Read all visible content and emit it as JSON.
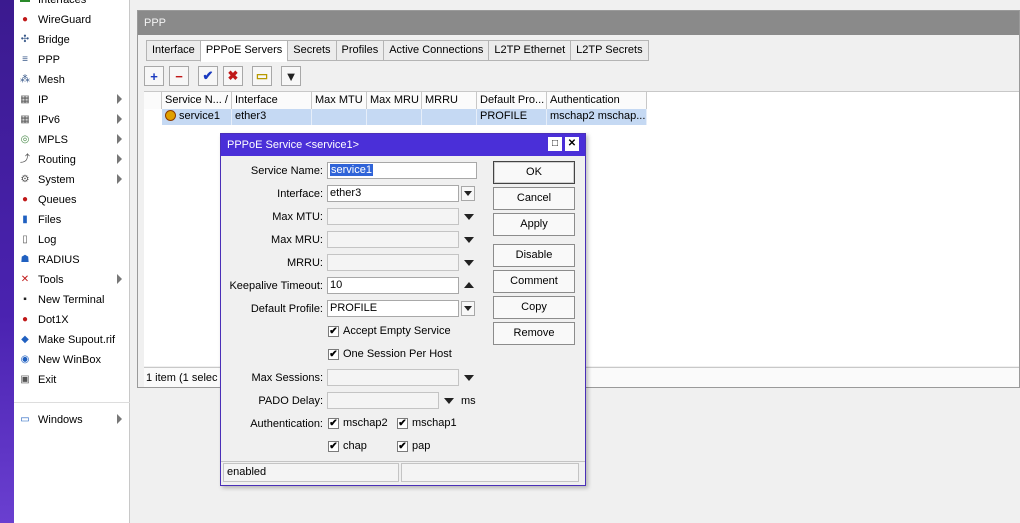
{
  "sidebar": {
    "items": [
      {
        "label": "Interfaces",
        "icon": "interfaces-icon",
        "glyph": "▬",
        "color": "#2a8a2a",
        "has_submenu": false
      },
      {
        "label": "WireGuard",
        "icon": "wireguard-icon",
        "glyph": "●",
        "color": "#c01818",
        "has_submenu": false
      },
      {
        "label": "Bridge",
        "icon": "bridge-icon",
        "glyph": "✣",
        "color": "#3a5a8a",
        "has_submenu": false
      },
      {
        "label": "PPP",
        "icon": "ppp-icon",
        "glyph": "≡",
        "color": "#3a5a8a",
        "has_submenu": false
      },
      {
        "label": "Mesh",
        "icon": "mesh-icon",
        "glyph": "⁂",
        "color": "#3a5a8a",
        "has_submenu": false
      },
      {
        "label": "IP",
        "icon": "ip-icon",
        "glyph": "▦",
        "color": "#555555",
        "has_submenu": true
      },
      {
        "label": "IPv6",
        "icon": "ipv6-icon",
        "glyph": "▦",
        "color": "#555555",
        "has_submenu": true
      },
      {
        "label": "MPLS",
        "icon": "mpls-icon",
        "glyph": "◎",
        "color": "#4a8a4a",
        "has_submenu": true
      },
      {
        "label": "Routing",
        "icon": "routing-icon",
        "glyph": "⤴",
        "color": "#555555",
        "has_submenu": true
      },
      {
        "label": "System",
        "icon": "system-icon",
        "glyph": "⚙",
        "color": "#555555",
        "has_submenu": true
      },
      {
        "label": "Queues",
        "icon": "queues-icon",
        "glyph": "●",
        "color": "#c01818",
        "has_submenu": false
      },
      {
        "label": "Files",
        "icon": "files-icon",
        "glyph": "▮",
        "color": "#2060c0",
        "has_submenu": false
      },
      {
        "label": "Log",
        "icon": "log-icon",
        "glyph": "▯",
        "color": "#555555",
        "has_submenu": false
      },
      {
        "label": "RADIUS",
        "icon": "radius-icon",
        "glyph": "☗",
        "color": "#2060c0",
        "has_submenu": false
      },
      {
        "label": "Tools",
        "icon": "tools-icon",
        "glyph": "✕",
        "color": "#c01818",
        "has_submenu": true
      },
      {
        "label": "New Terminal",
        "icon": "terminal-icon",
        "glyph": "▪",
        "color": "#222222",
        "has_submenu": false
      },
      {
        "label": "Dot1X",
        "icon": "dot1x-icon",
        "glyph": "●",
        "color": "#c01818",
        "has_submenu": false
      },
      {
        "label": "Make Supout.rif",
        "icon": "supout-icon",
        "glyph": "◆",
        "color": "#2060c0",
        "has_submenu": false
      },
      {
        "label": "New WinBox",
        "icon": "winbox-icon",
        "glyph": "◉",
        "color": "#2060c0",
        "has_submenu": false
      },
      {
        "label": "Exit",
        "icon": "exit-icon",
        "glyph": "▣",
        "color": "#555555",
        "has_submenu": false
      }
    ],
    "windows": {
      "label": "Windows",
      "icon": "windows-icon",
      "glyph": "▭",
      "color": "#2060c0",
      "has_submenu": true
    }
  },
  "ppp_window": {
    "title": "PPP",
    "tabs": [
      {
        "label": "Interface",
        "active": false
      },
      {
        "label": "PPPoE Servers",
        "active": true
      },
      {
        "label": "Secrets",
        "active": false
      },
      {
        "label": "Profiles",
        "active": false
      },
      {
        "label": "Active Connections",
        "active": false
      },
      {
        "label": "L2TP Ethernet",
        "active": false
      },
      {
        "label": "L2TP Secrets",
        "active": false
      }
    ],
    "toolbar": {
      "add": {
        "icon": "plus-icon",
        "glyph": "+",
        "color": "#1a3ac0"
      },
      "remove": {
        "icon": "minus-icon",
        "glyph": "−",
        "color": "#c01818"
      },
      "enable": {
        "icon": "check-icon",
        "glyph": "✔",
        "color": "#1a3ac0"
      },
      "disable": {
        "icon": "x-icon",
        "glyph": "✖",
        "color": "#c01818"
      },
      "comment": {
        "icon": "comment-icon",
        "glyph": "▭",
        "color": "#b89a00"
      },
      "filter": {
        "icon": "filter-icon",
        "glyph": "▼",
        "color": "#222222"
      }
    },
    "table": {
      "columns": [
        "Service N... /",
        "Interface",
        "Max MTU",
        "Max MRU",
        "MRRU",
        "Default Pro...",
        "Authentication"
      ],
      "rows": [
        {
          "service": "service1",
          "interface": "ether3",
          "max_mtu": "",
          "max_mru": "",
          "mrru": "",
          "default_profile": "PROFILE",
          "authentication": "mschap2 mschap...",
          "icon": "service-icon"
        }
      ]
    },
    "status": "1 item (1 selec"
  },
  "dialog": {
    "title": "PPPoE Service <service1>",
    "fields": {
      "service_name": {
        "label": "Service Name:",
        "value": "service1"
      },
      "interface": {
        "label": "Interface:",
        "value": "ether3"
      },
      "max_mtu": {
        "label": "Max MTU:",
        "value": ""
      },
      "max_mru": {
        "label": "Max MRU:",
        "value": ""
      },
      "mrru": {
        "label": "MRRU:",
        "value": ""
      },
      "keepalive": {
        "label": "Keepalive Timeout:",
        "value": "10"
      },
      "default_profile": {
        "label": "Default Profile:",
        "value": "PROFILE"
      },
      "max_sessions": {
        "label": "Max Sessions:",
        "value": ""
      },
      "pado_delay": {
        "label": "PADO Delay:",
        "value": "",
        "unit": "ms"
      },
      "authentication": {
        "label": "Authentication:"
      }
    },
    "checkboxes": {
      "accept_empty": {
        "label": "Accept Empty Service",
        "checked": true
      },
      "one_session": {
        "label": "One Session Per Host",
        "checked": true
      },
      "mschap2": {
        "label": "mschap2",
        "checked": true
      },
      "mschap1": {
        "label": "mschap1",
        "checked": true
      },
      "chap": {
        "label": "chap",
        "checked": true
      },
      "pap": {
        "label": "pap",
        "checked": true
      }
    },
    "buttons": {
      "ok": "OK",
      "cancel": "Cancel",
      "apply": "Apply",
      "disable": "Disable",
      "comment": "Comment",
      "copy": "Copy",
      "remove": "Remove"
    },
    "status": "enabled",
    "check_glyph": "✔"
  }
}
